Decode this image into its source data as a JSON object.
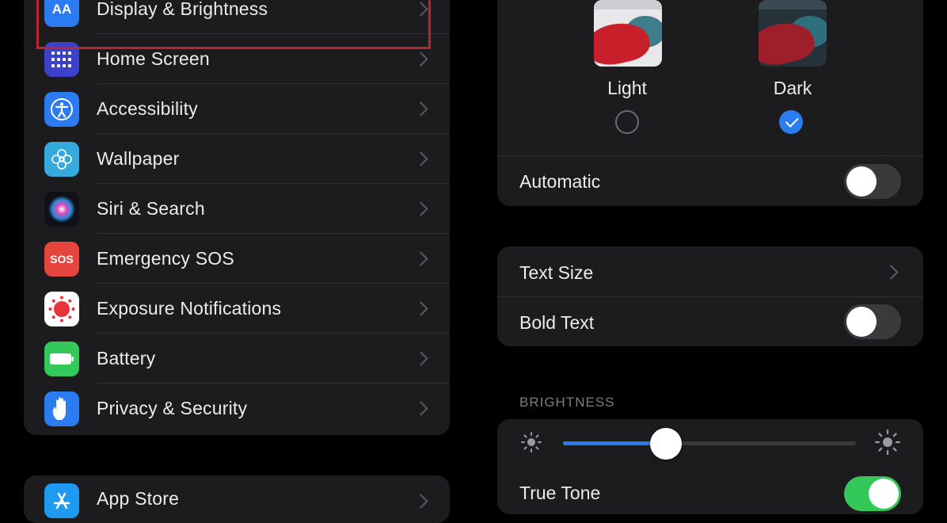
{
  "settings_list": {
    "items": [
      {
        "label": "Display & Brightness",
        "icon": "display-aa-icon",
        "icon_text": "AA",
        "color": "#2a7cf0"
      },
      {
        "label": "Home Screen",
        "icon": "home-grid-icon",
        "color": "#3b42c9"
      },
      {
        "label": "Accessibility",
        "icon": "accessibility-icon",
        "color": "#2a7cf0"
      },
      {
        "label": "Wallpaper",
        "icon": "flower-icon",
        "color": "#35aadc"
      },
      {
        "label": "Siri & Search",
        "icon": "siri-icon",
        "color": "#1f1f2a"
      },
      {
        "label": "Emergency SOS",
        "icon": "sos-icon",
        "icon_text": "SOS",
        "color": "#e6453e"
      },
      {
        "label": "Exposure Notifications",
        "icon": "exposure-icon",
        "color": "#ffffff"
      },
      {
        "label": "Battery",
        "icon": "battery-icon",
        "color": "#34c759"
      },
      {
        "label": "Privacy & Security",
        "icon": "hand-icon",
        "color": "#2a7cf0"
      }
    ]
  },
  "next_group": {
    "label": "App Store",
    "icon": "app-store-icon",
    "color": "#1e9bf0"
  },
  "appearance": {
    "light_label": "Light",
    "dark_label": "Dark",
    "selected": "Dark",
    "automatic_label": "Automatic",
    "automatic_on": false
  },
  "text_settings": {
    "text_size_label": "Text Size",
    "bold_text_label": "Bold Text",
    "bold_text_on": false
  },
  "brightness": {
    "header": "BRIGHTNESS",
    "level": 0.35,
    "true_tone_label": "True Tone",
    "true_tone_on": true
  },
  "colors": {
    "accent": "#2a7cf0",
    "toggle_on": "#34c759",
    "highlight": "#b9272e"
  }
}
